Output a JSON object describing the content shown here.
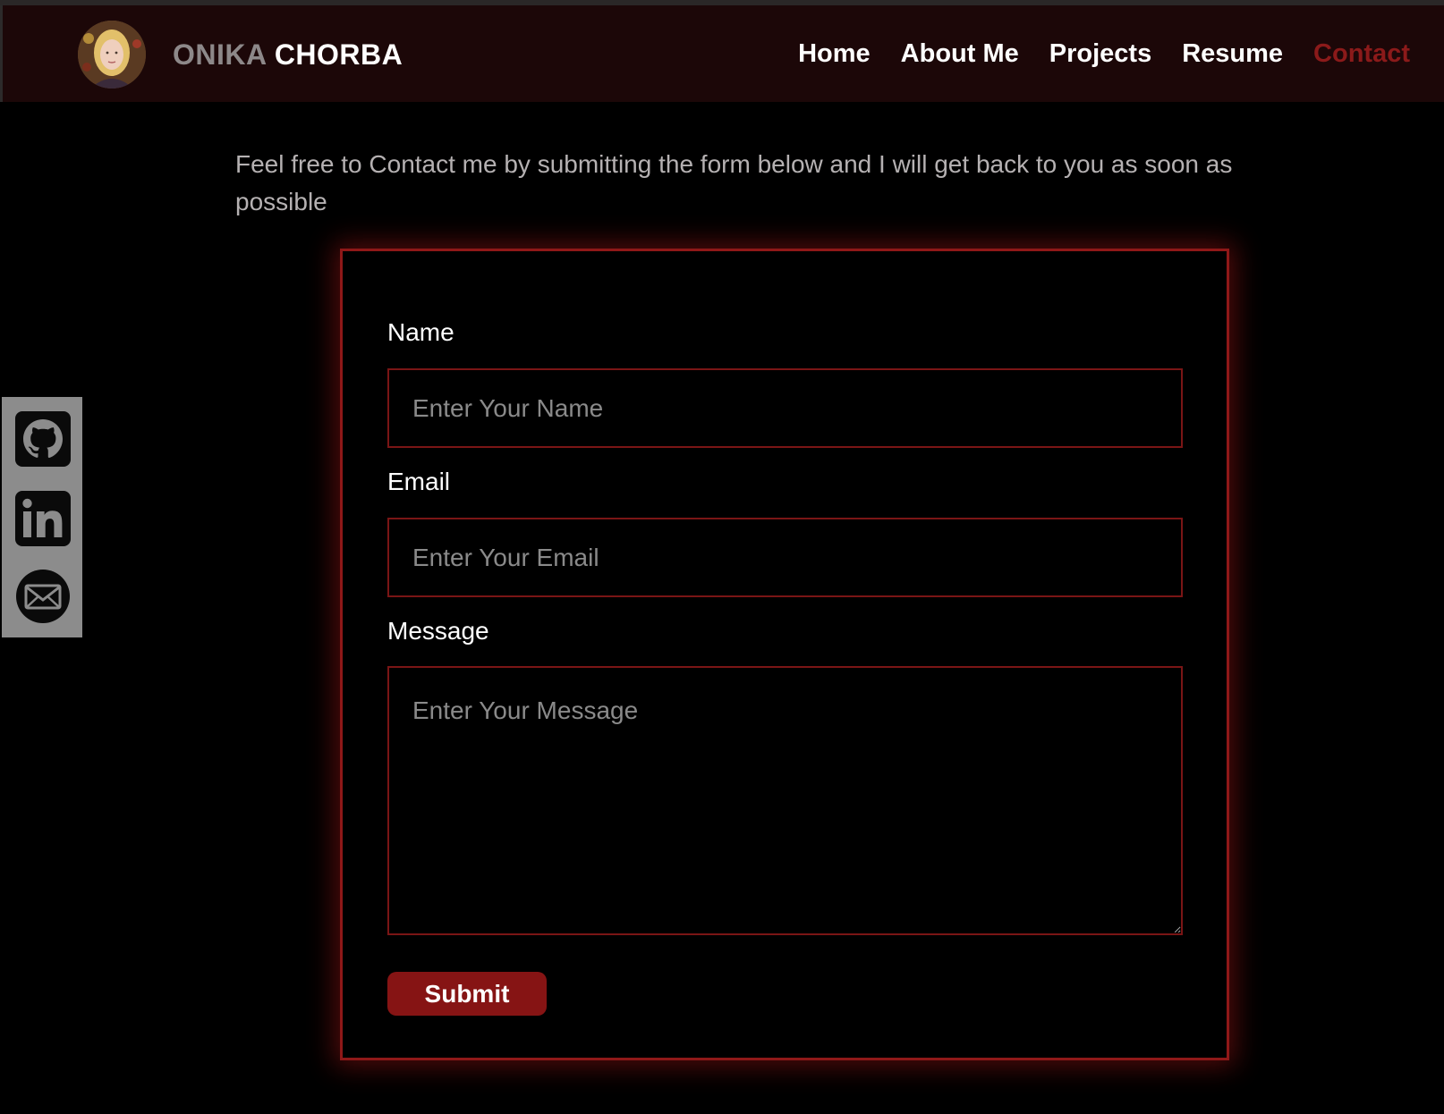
{
  "header": {
    "brand_first": "ONIKA",
    "brand_last": "CHORBA",
    "nav": [
      {
        "label": "Home"
      },
      {
        "label": "About Me"
      },
      {
        "label": "Projects"
      },
      {
        "label": "Resume"
      },
      {
        "label": "Contact",
        "active": true
      }
    ]
  },
  "intro_text": "Feel free to Contact me by submitting the form below and I will get back to you as soon as possible",
  "social": [
    {
      "icon": "github-icon"
    },
    {
      "icon": "linkedin-icon"
    },
    {
      "icon": "email-icon"
    }
  ],
  "form": {
    "name_label": "Name",
    "name_placeholder": "Enter Your Name",
    "email_label": "Email",
    "email_placeholder": "Enter Your Email",
    "message_label": "Message",
    "message_placeholder": "Enter Your Message",
    "submit_label": "Submit"
  },
  "colors": {
    "accent": "#8b1a1a",
    "navbar_bg": "#1c0708",
    "page_bg": "#000000",
    "social_bar_bg": "#8c8c8c"
  }
}
